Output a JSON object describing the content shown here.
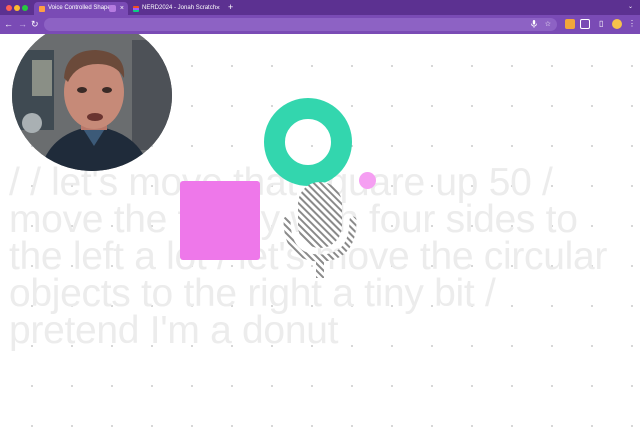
{
  "browser": {
    "tabs": [
      {
        "title": "Voice Controlled Shapes",
        "active": true
      },
      {
        "title": "NERD2024 - Jonah Scratch",
        "active": false
      }
    ],
    "new_tab_symbol": "+",
    "close_symbol": "×",
    "dropdown_symbol": "⌄",
    "nav": {
      "back": "←",
      "forward": "→",
      "reload": "↻"
    },
    "toolbar_icons": [
      "microphone-icon",
      "star-icon",
      "honey-extension-icon",
      "extensions-puzzle-icon",
      "side-panel-icon",
      "profile-avatar",
      "kebab-menu-icon"
    ]
  },
  "canvas": {
    "transcript": "/ / let's move that square up 50 / move the thingy with four sides to the left a lot / let's move the circular objects to the right a tiny bit / pretend I'm a donut",
    "shapes": [
      {
        "kind": "square",
        "color": "#ee78ea"
      },
      {
        "kind": "donut",
        "color": "#33d6ae"
      },
      {
        "kind": "circle",
        "color": "#f59ff2"
      }
    ],
    "mic_icon": "microphone-icon",
    "webcam": "presenter-webcam"
  },
  "colors": {
    "tab_bar": "#5c3191",
    "toolbar": "#7a4bb5",
    "transcript_text": "#ececec",
    "mic_stripes": "#8a8a8a"
  }
}
